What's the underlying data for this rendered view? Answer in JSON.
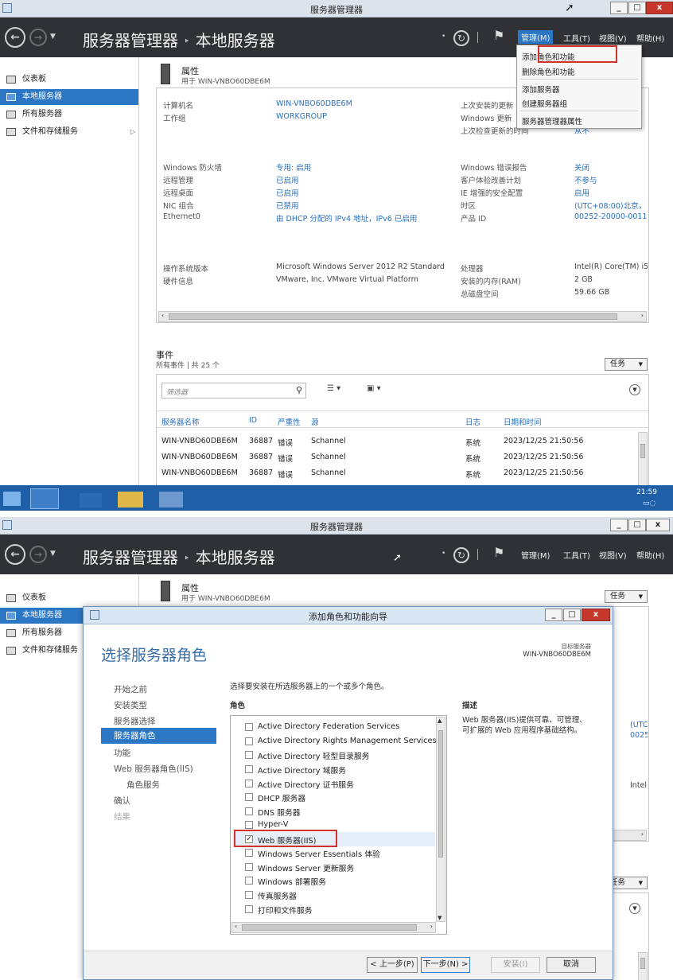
{
  "window": {
    "title": "服务器管理器",
    "min": "_",
    "max": "□",
    "close": "x"
  },
  "header": {
    "back": "←",
    "forward": "→",
    "breadcrumb_root": "服务器管理器",
    "breadcrumb_sep": "‣",
    "breadcrumb_page": "本地服务器",
    "menu": [
      "管理(M)",
      "工具(T)",
      "视图(V)",
      "帮助(H)"
    ]
  },
  "sidebar": {
    "items": [
      "仪表板",
      "本地服务器",
      "所有服务器",
      "文件和存储服务"
    ],
    "expand": "▷"
  },
  "properties": {
    "title": "属性",
    "subtitle": "用于 WIN-VNBO60DBE6M",
    "tasks": "任务",
    "left": [
      {
        "label": "计算机名",
        "value": "WIN-VNBO60DBE6M"
      },
      {
        "label": "工作组",
        "value": "WORKGROUP"
      },
      {
        "label": "Windows 防火墙",
        "value": "专用: 启用"
      },
      {
        "label": "远程管理",
        "value": "已启用"
      },
      {
        "label": "远程桌面",
        "value": "已启用"
      },
      {
        "label": "NIC 组合",
        "value": "已禁用"
      },
      {
        "label": "Ethernet0",
        "value": "由 DHCP 分配的 IPv4 地址，IPv6 已启用"
      },
      {
        "label": "操作系统版本",
        "value": "Microsoft Windows Server 2012 R2 Standard"
      },
      {
        "label": "硬件信息",
        "value": "VMware, Inc. VMware Virtual Platform"
      }
    ],
    "right": [
      {
        "label": "上次安装的更新",
        "value": ""
      },
      {
        "label": "Windows 更新",
        "value": ""
      },
      {
        "label": "上次检查更新的时间",
        "value": "从不"
      },
      {
        "label": "Windows 错误报告",
        "value": "关闭"
      },
      {
        "label": "客户体验改善计划",
        "value": "不参与"
      },
      {
        "label": "IE 增强的安全配置",
        "value": "启用"
      },
      {
        "label": "时区",
        "value": "(UTC+08:00)北京，"
      },
      {
        "label": "产品 ID",
        "value": "00252-20000-0011"
      },
      {
        "label": "处理器",
        "value": "Intel(R) Core(TM) i5"
      },
      {
        "label": "安装的内存(RAM)",
        "value": "2 GB"
      },
      {
        "label": "总磁盘空间",
        "value": "59.66 GB"
      }
    ]
  },
  "manage_menu": {
    "items": [
      "添加角色和功能",
      "删除角色和功能",
      "添加服务器",
      "创建服务器组",
      "服务器管理器属性"
    ]
  },
  "events": {
    "title": "事件",
    "subtitle": "所有事件 | 共 25 个",
    "tasks": "任务",
    "filter_placeholder": "筛选器",
    "columns": [
      "服务器名称",
      "ID",
      "严重性",
      "源",
      "日志",
      "日期和时间"
    ],
    "rows": [
      [
        "WIN-VNBO60DBE6M",
        "36887",
        "错误",
        "Schannel",
        "系统",
        "2023/12/25 21:50:56"
      ],
      [
        "WIN-VNBO60DBE6M",
        "36887",
        "错误",
        "Schannel",
        "系统",
        "2023/12/25 21:50:56"
      ],
      [
        "WIN-VNBO60DBE6M",
        "36887",
        "错误",
        "Schannel",
        "系统",
        "2023/12/25 21:50:56"
      ]
    ]
  },
  "taskbar": {
    "time": "21:59"
  },
  "wizard": {
    "title": "添加角色和功能向导",
    "heading": "选择服务器角色",
    "target_label": "目标服务器",
    "target_server": "WIN-VNBO60DBE6M",
    "steps": [
      "开始之前",
      "安装类型",
      "服务器选择",
      "服务器角色",
      "功能",
      "Web 服务器角色(IIS)",
      "角色服务",
      "确认",
      "结果"
    ],
    "instruction": "选择要安装在所选服务器上的一个或多个角色。",
    "roles_label": "角色",
    "description_label": "描述",
    "description": "Web 服务器(IIS)提供可靠、可管理、可扩展的 Web 应用程序基础结构。",
    "roles": [
      {
        "name": "Active Directory Federation Services",
        "checked": false
      },
      {
        "name": "Active Directory Rights Management Services",
        "checked": false
      },
      {
        "name": "Active Directory 轻型目录服务",
        "checked": false
      },
      {
        "name": "Active Directory 域服务",
        "checked": false
      },
      {
        "name": "Active Directory 证书服务",
        "checked": false
      },
      {
        "name": "DHCP 服务器",
        "checked": false
      },
      {
        "name": "DNS 服务器",
        "checked": false
      },
      {
        "name": "Hyper-V",
        "checked": false
      },
      {
        "name": "Web 服务器(IIS)",
        "checked": true
      },
      {
        "name": "Windows Server Essentials 体验",
        "checked": false
      },
      {
        "name": "Windows Server 更新服务",
        "checked": false
      },
      {
        "name": "Windows 部署服务",
        "checked": false
      },
      {
        "name": "传真服务器",
        "checked": false
      },
      {
        "name": "打印和文件服务",
        "checked": false
      }
    ],
    "buttons": {
      "prev": "< 上一步(P)",
      "next": "下一步(N) >",
      "install": "安装(I)",
      "cancel": "取消"
    }
  },
  "colors": {
    "header_bg": "#2f3135",
    "selection": "#2b77c4",
    "link": "#2a6fbf",
    "highlight_box": "#d0312d"
  }
}
